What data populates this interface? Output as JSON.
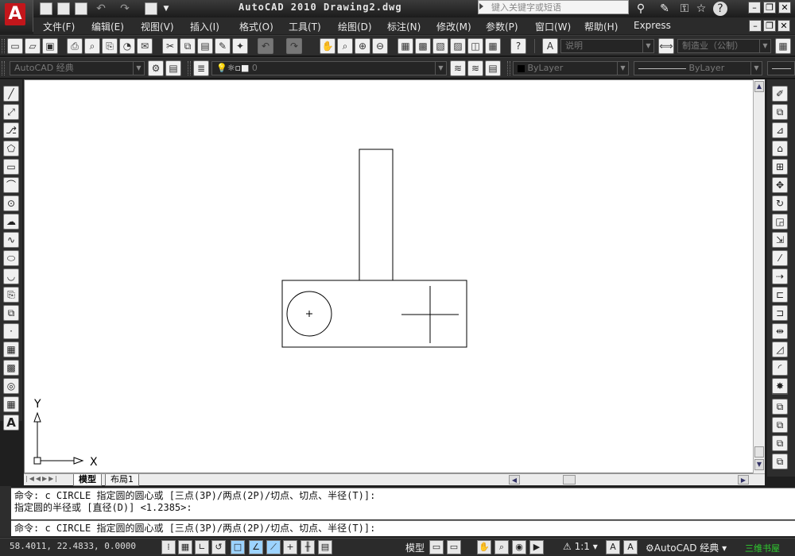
{
  "title": {
    "app": "AutoCAD 2010",
    "document": "Drawing2.dwg"
  },
  "search": {
    "placeholder": "键入关键字或短语"
  },
  "menus": [
    "文件(F)",
    "编辑(E)",
    "视图(V)",
    "插入(I)",
    "格式(O)",
    "工具(T)",
    "绘图(D)",
    "标注(N)",
    "修改(M)",
    "参数(P)",
    "窗口(W)",
    "帮助(H)",
    "Express"
  ],
  "toolbar": {
    "text_style": "说明",
    "dim_style": "制造业（公制）",
    "workspace": "AutoCAD 经典",
    "layer": "0",
    "color": "ByLayer",
    "linetype": "ByLayer"
  },
  "axes": {
    "y": "Y",
    "x": "X"
  },
  "tabs": [
    "模型",
    "布局1"
  ],
  "command": {
    "line1": "命令: c CIRCLE 指定圆的圆心或 [三点(3P)/两点(2P)/切点、切点、半径(T)]:",
    "line2": "指定圆的半径或 [直径(D)] <1.2385>:",
    "current": "命令: c CIRCLE 指定圆的圆心或 [三点(3P)/两点(2P)/切点、切点、半径(T)]:"
  },
  "status": {
    "coords": "58.4011, 22.4833, 0.0000",
    "model": "模型",
    "scale": "1:1",
    "workspace": "AutoCAD 经典",
    "watermark": "三维书屋"
  },
  "colors": {
    "accent": "#c2161b",
    "canvas": "#ffffff",
    "chrome": "#2b2b2b"
  }
}
